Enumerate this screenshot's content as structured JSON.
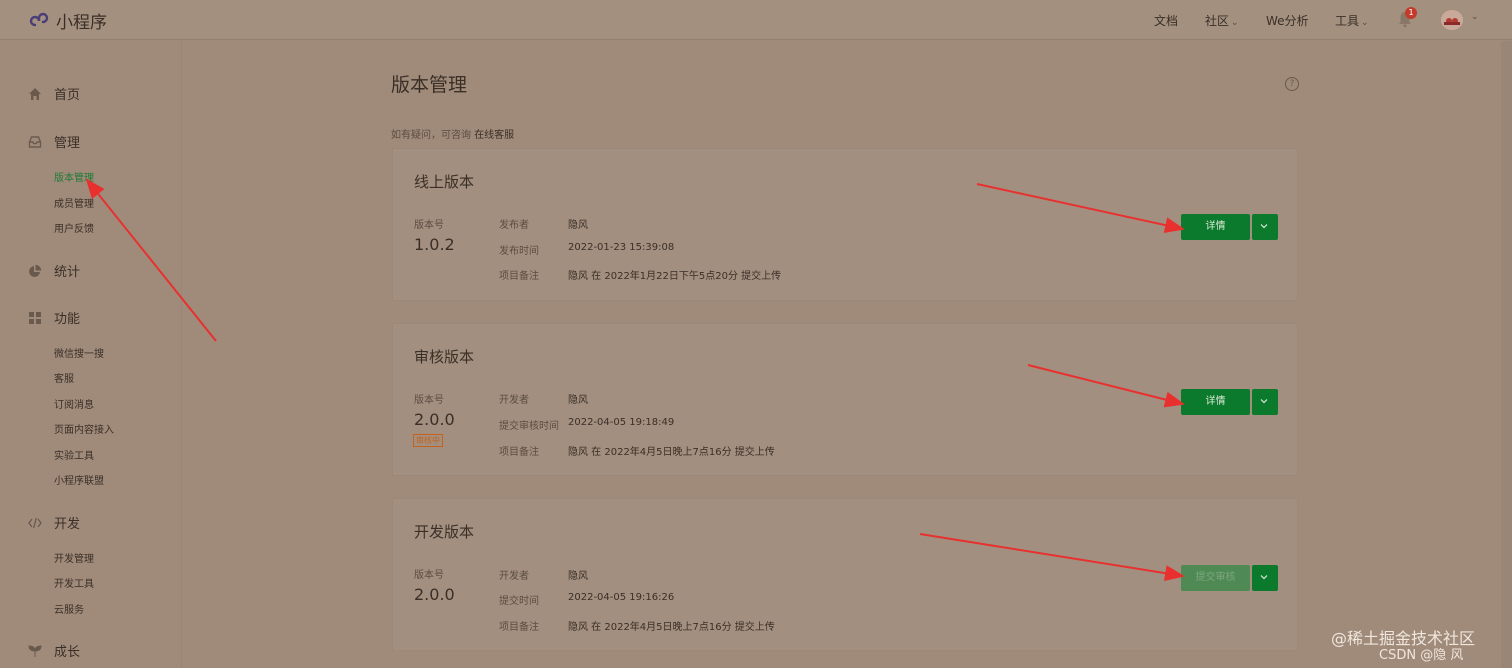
{
  "app": {
    "title": "小程序"
  },
  "topnav": {
    "docs": "文档",
    "community": "社区",
    "we_analysis": "We分析",
    "tools": "工具",
    "notification_count": "1"
  },
  "sidebar": {
    "home": "首页",
    "manage": "管理",
    "manage_items": [
      "版本管理",
      "成员管理",
      "用户反馈"
    ],
    "stats": "统计",
    "features": "功能",
    "feature_items": [
      "微信搜一搜",
      "客服",
      "订阅消息",
      "页面内容接入",
      "实验工具",
      "小程序联盟"
    ],
    "dev": "开发",
    "dev_items": [
      "开发管理",
      "开发工具",
      "云服务"
    ],
    "growth": "成长"
  },
  "main": {
    "title": "版本管理",
    "help_icon_text": "?",
    "tip_prefix": "如有疑问，可咨询",
    "tip_link": "在线客服"
  },
  "cards": [
    {
      "title": "线上版本",
      "version_label": "版本号",
      "version": "1.0.2",
      "rows": [
        {
          "k": "发布者",
          "v": "隐风"
        },
        {
          "k": "发布时间",
          "v": "2022-01-23 15:39:08"
        },
        {
          "k": "项目备注",
          "v": "隐风 在 2022年1月22日下午5点20分 提交上传"
        }
      ],
      "button": "详情"
    },
    {
      "title": "审核版本",
      "version_label": "版本号",
      "version": "2.0.0",
      "status_tag": "审核中",
      "rows": [
        {
          "k": "开发者",
          "v": "隐风"
        },
        {
          "k": "提交审核时间",
          "v": "2022-04-05 19:18:49"
        },
        {
          "k": "项目备注",
          "v": "隐风 在 2022年4月5日晚上7点16分 提交上传"
        }
      ],
      "button": "详情"
    },
    {
      "title": "开发版本",
      "version_label": "版本号",
      "version": "2.0.0",
      "rows": [
        {
          "k": "开发者",
          "v": "隐风"
        },
        {
          "k": "提交时间",
          "v": "2022-04-05 19:16:26"
        },
        {
          "k": "项目备注",
          "v": "隐风 在 2022年4月5日晚上7点16分 提交上传"
        }
      ],
      "button": "提交审核"
    }
  ],
  "watermark": {
    "main": "@稀土掘金技术社区",
    "csdn": "CSDN @隐 风"
  },
  "colors": {
    "accent": "#0b7a2c",
    "active_nav": "#1e7a34",
    "annotation": "#e8302f",
    "badge": "#c23a2b"
  }
}
